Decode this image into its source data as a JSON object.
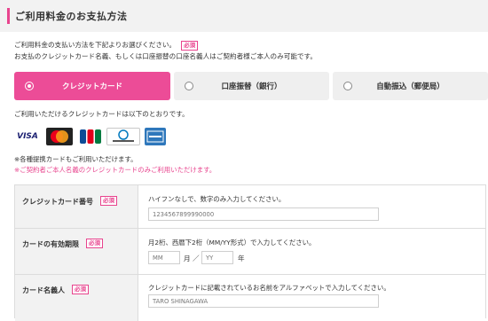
{
  "section": {
    "title": "ご利用料金のお支払方法"
  },
  "intro": {
    "line1": "ご利用料金の支払い方法を下記よりお選びください。",
    "required": "必須",
    "line2": "お支払のクレジットカード名義、もしくは口座振替の口座名義人はご契約者様ご本人のみ可能です。"
  },
  "methods": [
    {
      "label": "クレジットカード",
      "selected": true
    },
    {
      "label": "口座振替（銀行）",
      "selected": false
    },
    {
      "label": "自動振込（郵便局）",
      "selected": false
    }
  ],
  "available_text": "ご利用いただけるクレジットカードは以下のとおりです。",
  "cards": [
    {
      "name": "VISA",
      "icon": "visa-logo"
    },
    {
      "name": "MasterCard",
      "icon": "mastercard-logo"
    },
    {
      "name": "JCB",
      "icon": "jcb-logo"
    },
    {
      "name": "Diners Club",
      "icon": "diners-club-logo"
    },
    {
      "name": "AMERICAN EXPRESS",
      "icon": "amex-logo"
    }
  ],
  "notes": {
    "note1": "※各種提携カードもご利用いただけます。",
    "note2": "※ご契約者ご本人名義のクレジットカードのみご利用いただけます。"
  },
  "form": {
    "card_number": {
      "label": "クレジットカード番号",
      "required": "必須",
      "description": "ハイフンなしで、数字のみ入力してください。",
      "placeholder": "1234567899990000"
    },
    "expiry": {
      "label": "カードの有効期限",
      "required": "必須",
      "description": "月2桁、西暦下2桁（MM/YY形式）で入力してください。",
      "month_placeholder": "MM",
      "month_unit": "月",
      "slash": "／",
      "year_placeholder": "YY",
      "year_unit": "年"
    },
    "holder": {
      "label": "カード名義人",
      "required": "必須",
      "description": "クレジットカードに記載されているお名前をアルファベットで入力してください。",
      "placeholder": "TARO SHINAGAWA"
    }
  },
  "colors": {
    "accent": "#e8448e",
    "active_tab": "#ec4c97",
    "header_bg": "#f2f2f2"
  }
}
